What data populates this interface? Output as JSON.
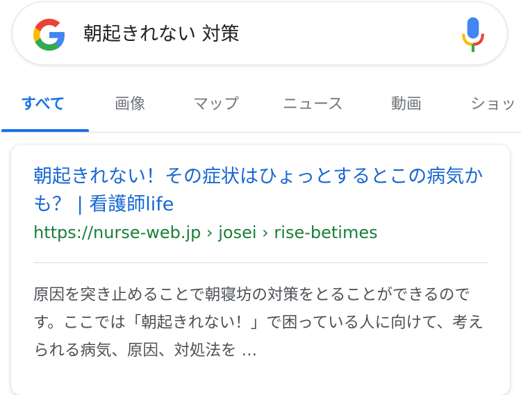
{
  "search": {
    "query": "朝起きれない 対策"
  },
  "tabs": [
    {
      "label": "すべて",
      "active": true
    },
    {
      "label": "画像",
      "active": false
    },
    {
      "label": "マップ",
      "active": false
    },
    {
      "label": "ニュース",
      "active": false
    },
    {
      "label": "動画",
      "active": false
    },
    {
      "label": "ショッ",
      "active": false
    }
  ],
  "result": {
    "title": "朝起きれない！その症状はひょっとするとこの病気かも？ | 看護師life",
    "url": "https://nurse-web.jp › josei › rise-betimes",
    "snippet": "原因を突き止めることで朝寝坊の対策をとることができるのです。ここでは「朝起きれない！」で困っている人に向けて、考えられる病気、原因、対処法を …"
  },
  "colors": {
    "accent": "#1a73e8",
    "link": "#1967d2",
    "url_green": "#188038",
    "tab_inactive": "#70757a"
  },
  "icons": {
    "logo": "google-g-logo",
    "mic": "microphone-icon"
  }
}
